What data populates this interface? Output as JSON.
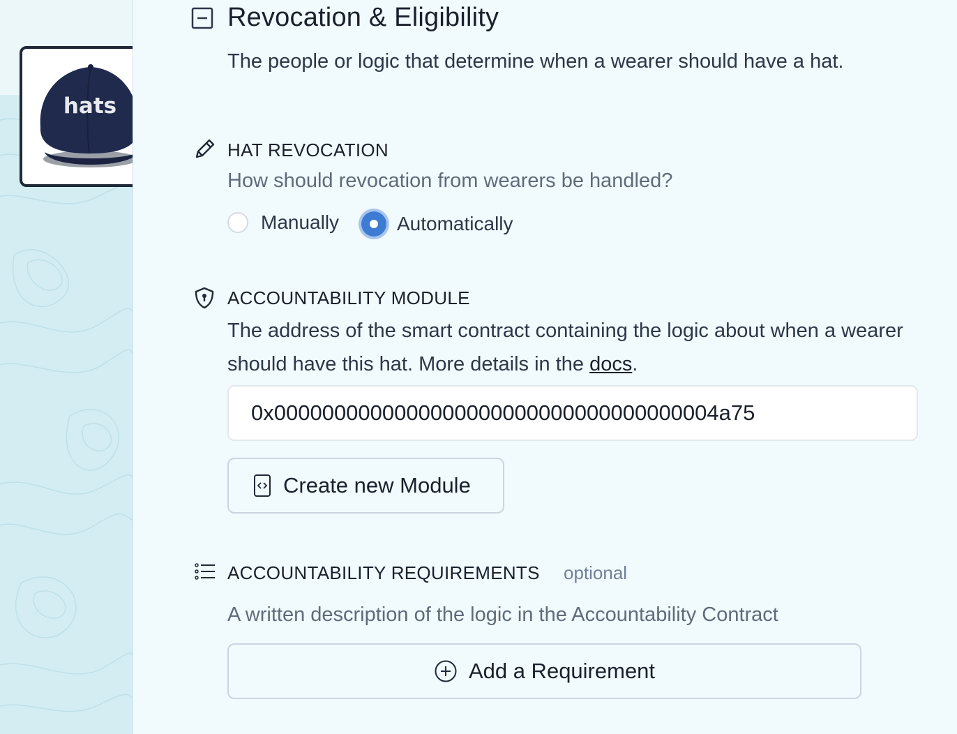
{
  "sidebar": {
    "hat_image_text": "hats",
    "hat_image_alt": "hats cap"
  },
  "section": {
    "title": "Revocation & Eligibility",
    "description": "The people or logic that determine when a wearer should have a hat.",
    "collapse_icon": "minus-square-icon"
  },
  "revocation": {
    "label": "HAT REVOCATION",
    "icon": "pencil-icon",
    "question": "How should revocation from wearers be handled?",
    "options": [
      {
        "label": "Manually",
        "selected": false
      },
      {
        "label": "Automatically",
        "selected": true
      }
    ]
  },
  "accountability_module": {
    "label": "ACCOUNTABILITY MODULE",
    "icon": "shield-icon",
    "description_prefix": "The address of the smart contract containing the logic about when a wearer should have this hat. More details in the ",
    "docs_link": "docs",
    "description_suffix": ".",
    "address_value": "0x0000000000000000000000000000000000004a75",
    "create_button": "Create new Module",
    "create_icon": "code-file-icon"
  },
  "requirements": {
    "label": "ACCOUNTABILITY REQUIREMENTS",
    "optional_tag": "optional",
    "icon": "list-icon",
    "description": "A written description of the logic in the Accountability Contract",
    "add_button": "Add a Requirement",
    "add_icon": "plus-circle-icon"
  },
  "colors": {
    "background": "#f1fafd",
    "radio_selected": "#3e7bd3",
    "sidebar": "#d3edf3"
  }
}
